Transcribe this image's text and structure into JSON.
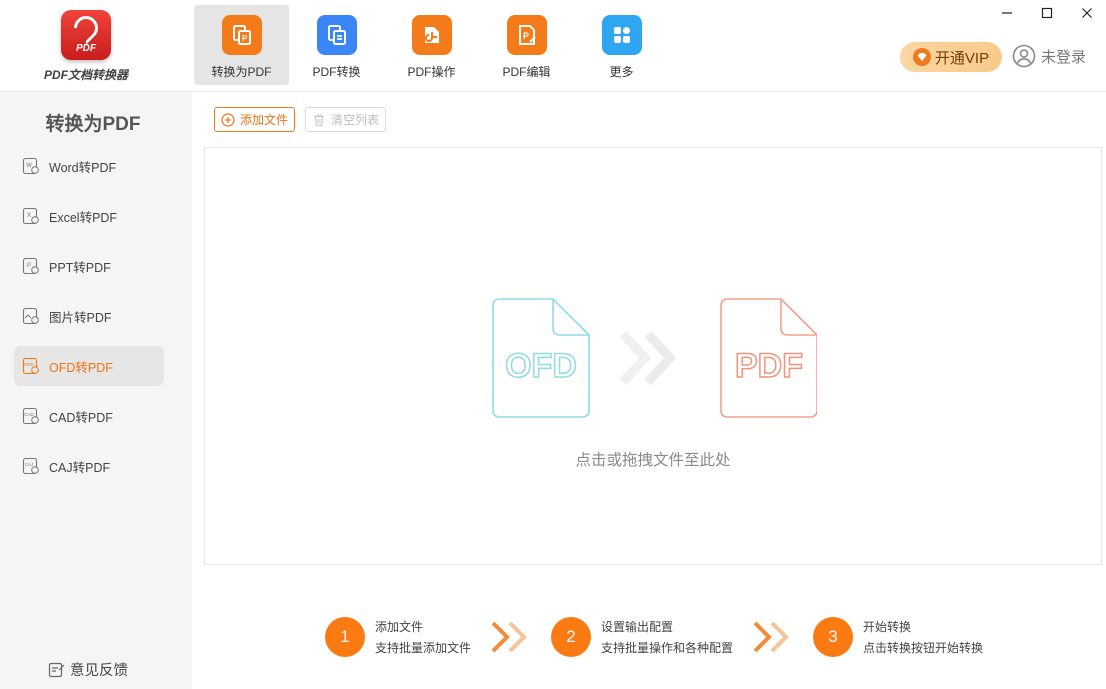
{
  "app": {
    "logo_badge": "PDF",
    "name": "PDF文档转换器"
  },
  "topnav": [
    {
      "label": "转换为PDF",
      "icon": "to-pdf-icon",
      "color": "#f47b1a",
      "active": true
    },
    {
      "label": "PDF转换",
      "icon": "pdf-convert-icon",
      "color": "#3a86f5",
      "active": false
    },
    {
      "label": "PDF操作",
      "icon": "pdf-operate-icon",
      "color": "#f47b1a",
      "active": false
    },
    {
      "label": "PDF编辑",
      "icon": "pdf-edit-icon",
      "color": "#f47b1a",
      "active": false
    },
    {
      "label": "更多",
      "icon": "more-apps-icon",
      "color": "#2fa6f2",
      "active": false
    }
  ],
  "header": {
    "vip_label": "开通VIP",
    "login_label": "未登录"
  },
  "sidebar": {
    "title": "转换为PDF",
    "items": [
      {
        "label": "Word转PDF",
        "icon_text": "W",
        "active": false
      },
      {
        "label": "Excel转PDF",
        "icon_text": "X",
        "active": false
      },
      {
        "label": "PPT转PDF",
        "icon_text": "P",
        "active": false
      },
      {
        "label": "图片转PDF",
        "icon_text": "",
        "active": false
      },
      {
        "label": "OFD转PDF",
        "icon_text": "OFD",
        "active": true
      },
      {
        "label": "CAD转PDF",
        "icon_text": "CAD",
        "active": false
      },
      {
        "label": "CAJ转PDF",
        "icon_text": "CAJ",
        "active": false
      }
    ],
    "feedback_label": "意见反馈"
  },
  "toolbar": {
    "add_label": "添加文件",
    "clear_label": "清空列表"
  },
  "dropzone": {
    "from_label": "OFD",
    "to_label": "PDF",
    "hint": "点击或拖拽文件至此处"
  },
  "steps": [
    {
      "num": "1",
      "title": "添加文件",
      "desc": "支持批量添加文件"
    },
    {
      "num": "2",
      "title": "设置输出配置",
      "desc": "支持批量操作和各种配置"
    },
    {
      "num": "3",
      "title": "开始转换",
      "desc": "点击转换按钮开始转换"
    }
  ],
  "colors": {
    "accent": "#f07316",
    "ofd": "#7fd6e6",
    "pdf": "#f2937a"
  }
}
